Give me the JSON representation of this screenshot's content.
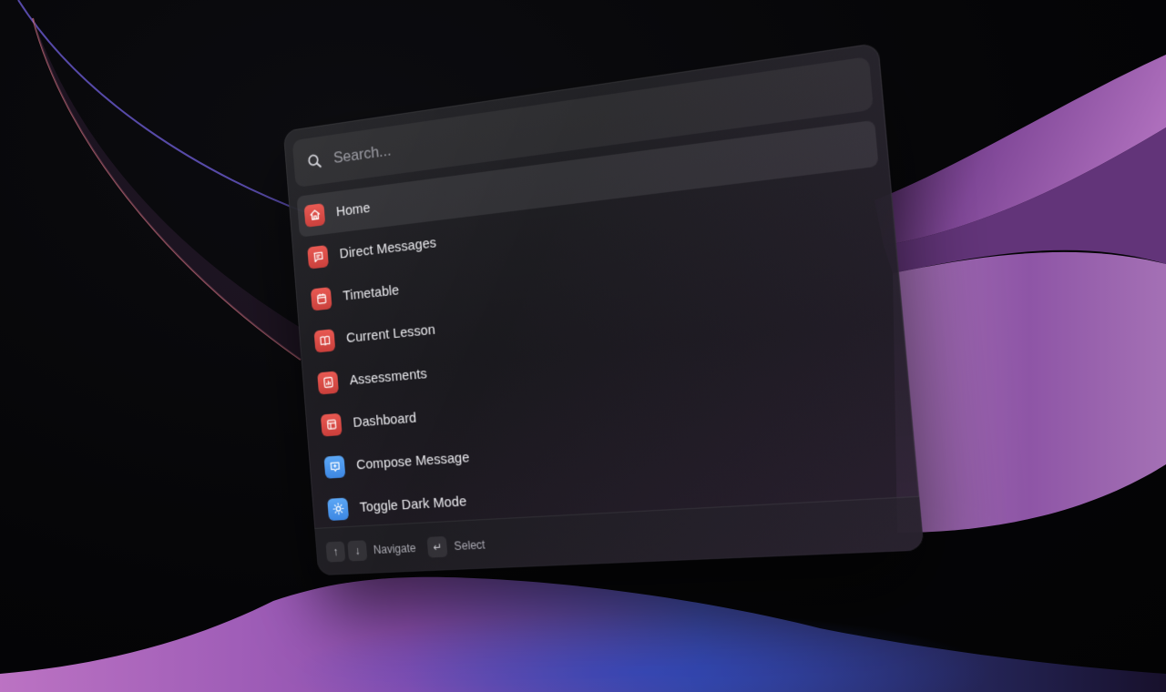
{
  "search": {
    "placeholder": "Search..."
  },
  "items": [
    {
      "label": "Home",
      "icon": "home-icon",
      "color": "#e0504a",
      "selected": true
    },
    {
      "label": "Direct Messages",
      "icon": "message-icon",
      "color": "#e0504a"
    },
    {
      "label": "Timetable",
      "icon": "calendar-icon",
      "color": "#e0504a"
    },
    {
      "label": "Current Lesson",
      "icon": "book-icon",
      "color": "#e0504a"
    },
    {
      "label": "Assessments",
      "icon": "chart-icon",
      "color": "#e0504a"
    },
    {
      "label": "Dashboard",
      "icon": "layout-icon",
      "color": "#e0504a"
    },
    {
      "label": "Compose Message",
      "icon": "compose-icon",
      "color": "#4a97ec"
    },
    {
      "label": "Toggle Dark Mode",
      "icon": "sun-icon",
      "color": "#4a97ec"
    }
  ],
  "footer": {
    "up_key": "↑",
    "down_key": "↓",
    "navigate_label": "Navigate",
    "enter_key": "↵",
    "select_label": "Select"
  }
}
